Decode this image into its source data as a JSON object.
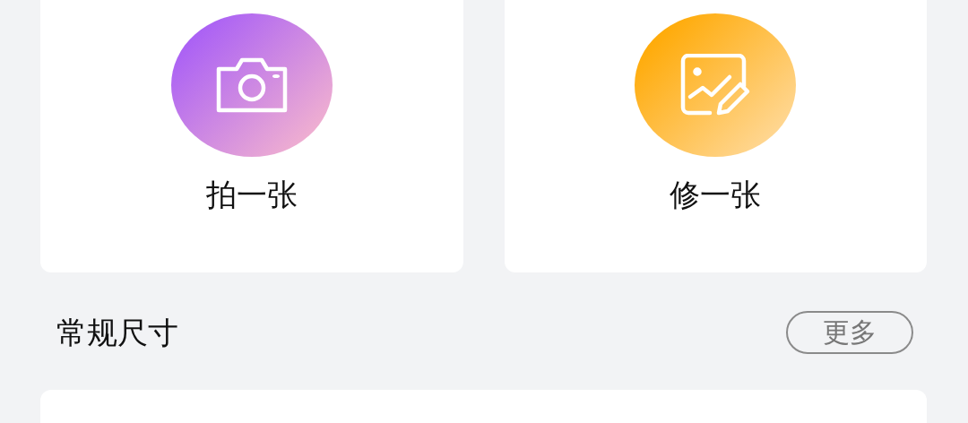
{
  "actions": [
    {
      "kind": "camera",
      "label": "拍一张"
    },
    {
      "kind": "edit-image",
      "label": "修一张"
    }
  ],
  "section": {
    "title": "常规尺寸",
    "more_button": "更多"
  }
}
